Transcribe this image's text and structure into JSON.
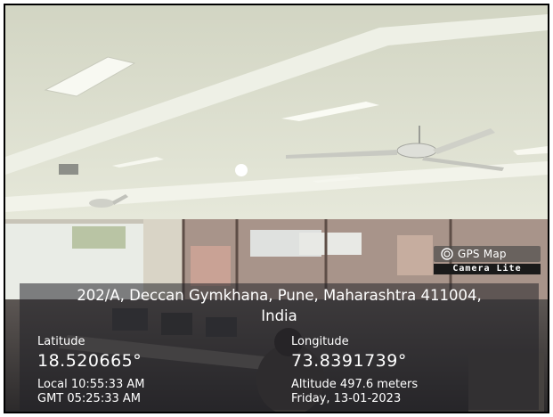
{
  "badge": {
    "icon": "camera-lens-icon",
    "title": "GPS Map",
    "subtitle": "Camera Lite"
  },
  "location": {
    "address_line1": "202/A, Deccan Gymkhana, Pune, Maharashtra 411004,",
    "address_line2": "India",
    "latitude_label": "Latitude",
    "latitude_value": "18.520665°",
    "longitude_label": "Longitude",
    "longitude_value": "73.8391739°",
    "local_time": "Local 10:55:33 AM",
    "gmt_time": "GMT 05:25:33 AM",
    "altitude": "Altitude 497.6 meters",
    "date": "Friday, 13-01-2023"
  },
  "colors": {
    "overlay": "#2a2a30",
    "ceiling": "#d9dccd",
    "floor": "#4a4545"
  }
}
